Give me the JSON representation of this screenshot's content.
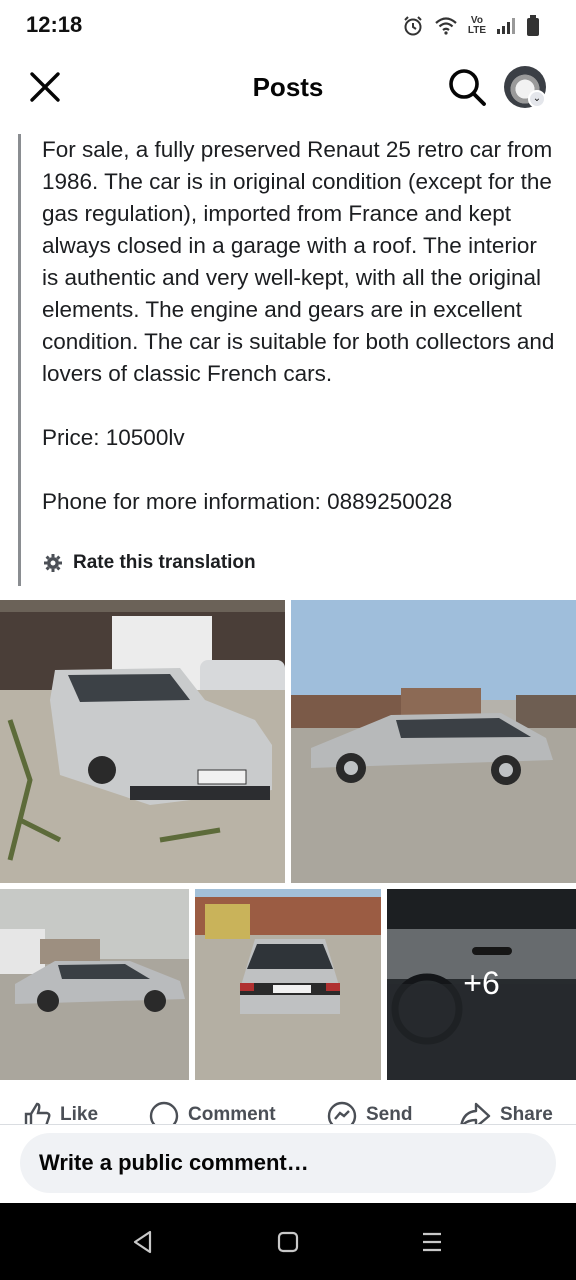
{
  "status_bar": {
    "time": "12:18",
    "icons": [
      "alarm-icon",
      "wifi-icon",
      "volte-icon",
      "signal-icon",
      "battery-icon"
    ],
    "volte_line1": "Vo",
    "volte_line2": "LTE"
  },
  "header": {
    "title": "Posts",
    "close_icon": "close-icon",
    "search_icon": "search-icon"
  },
  "post": {
    "text": "For sale, a fully preserved Renaut 25 retro car from 1986. The car is in original condition (except for the gas regulation), imported from France and kept always closed in a garage with a roof. The interior is authentic and very well-kept, with all the original elements. The engine and gears are in excellent condition. The car is suitable for both collectors and lovers of classic French cars.\n\nPrice: 10500lv\n\nPhone for more information: 0889250028",
    "translation_label": "Rate this translation"
  },
  "photos": {
    "more_count": "+6",
    "plate_text": "BP 0381 AH"
  },
  "actions": {
    "like": "Like",
    "comment": "Comment",
    "send": "Send",
    "share": "Share"
  },
  "comment_box": {
    "placeholder": "Write a public comment…"
  },
  "colors": {
    "text": "#1c1e21",
    "secondary": "#4b4f56",
    "input_bg": "#f0f2f5"
  }
}
